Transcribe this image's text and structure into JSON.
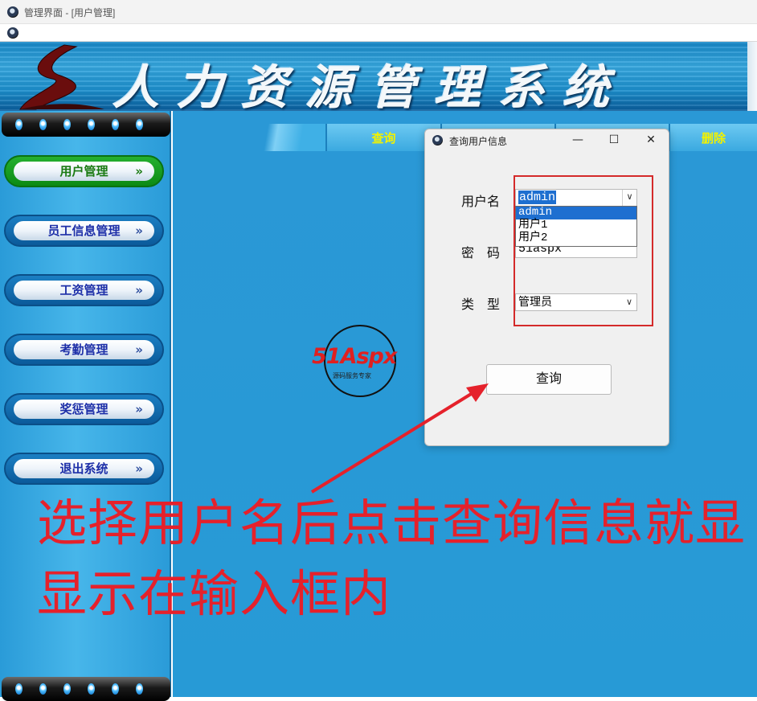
{
  "window": {
    "title": "管理界面 - [用户管理]"
  },
  "banner": {
    "title": "人力资源管理系统"
  },
  "sidebar": {
    "items": [
      {
        "label": "用户管理",
        "active": true
      },
      {
        "label": "员工信息管理",
        "active": false
      },
      {
        "label": "工资管理",
        "active": false
      },
      {
        "label": "考勤管理",
        "active": false
      },
      {
        "label": "奖惩管理",
        "active": false
      },
      {
        "label": "退出系统",
        "active": false
      }
    ],
    "chevron": "»"
  },
  "toolbar": {
    "tabs": [
      {
        "label": "查询"
      },
      {
        "label": "删除"
      }
    ]
  },
  "logo": {
    "text": "51Aspx",
    "subtitle": "源码服务专家"
  },
  "dialog": {
    "title": "查询用户信息",
    "controls": {
      "minimize": "—",
      "maximize": "☐",
      "close": "✕"
    },
    "username_label": "用户名",
    "username_value": "admin",
    "password_label": "密　码",
    "password_value": "51aspx",
    "type_label": "类　型",
    "type_value": "管理员",
    "dropdown_options": [
      "admin",
      "用户1",
      "用户2"
    ],
    "query_button": "查询"
  },
  "annotation": {
    "line1": "选择用户名后点击查询信息就显",
    "line2": "显示在输入框内",
    "color": "#e5212b"
  },
  "colors": {
    "accent_blue": "#2a98d6",
    "highlight": "#d42a2a",
    "selection": "#1e6fd0"
  }
}
